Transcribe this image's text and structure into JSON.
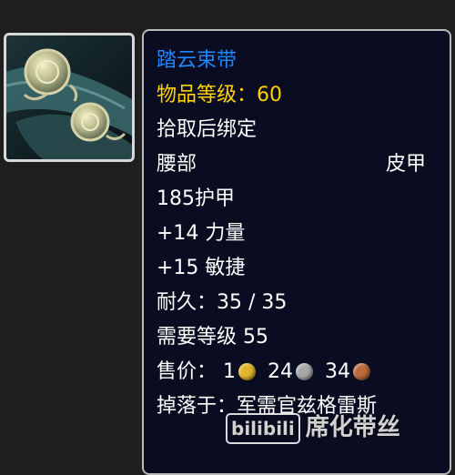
{
  "item": {
    "icon": "belt-icon",
    "name": "踏云束带",
    "item_level": "物品等级：60",
    "bind": "拾取后绑定",
    "slot": "腰部",
    "armor_type": "皮甲",
    "armor": "185护甲",
    "stat_strength": "+14 力量",
    "stat_agility": "+15 敏捷",
    "durability": "耐久：35 / 35",
    "required_level": "需要等级 55",
    "sell_price_label": "售价：",
    "sell_gold": "1",
    "sell_silver": "24",
    "sell_copper": "34",
    "drop": "掉落于：军需官兹格雷斯"
  },
  "colors": {
    "name": "#1e86ff",
    "item_level": "#ffd100",
    "text": "#ffffff",
    "tooltip_bg": "#0a0d22"
  },
  "watermark": {
    "logo": "bilibili",
    "text": "席化带丝"
  }
}
